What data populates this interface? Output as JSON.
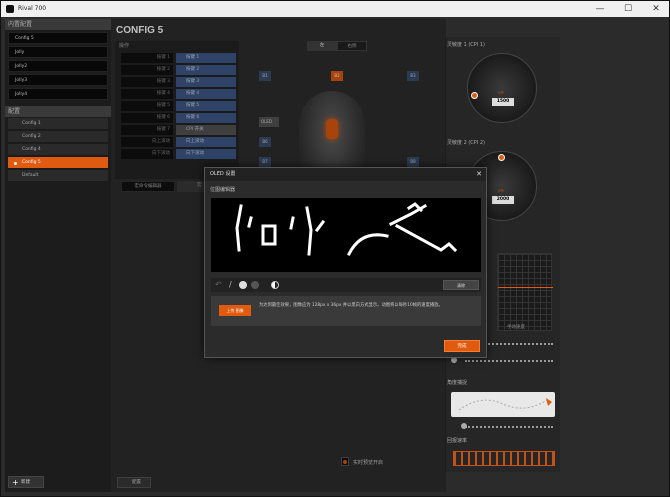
{
  "window": {
    "title": "Rival 700",
    "minimize": "—",
    "maximize": "☐",
    "close": "✕"
  },
  "sidebar": {
    "library_header": "内置配置",
    "library_items": [
      "Config 5",
      "Jolly",
      "Jolly2",
      "Jolly3",
      "Jolly4"
    ],
    "configs_header": "配置",
    "configs": [
      {
        "label": "Config 1",
        "active": false
      },
      {
        "label": "Config 2",
        "active": false
      },
      {
        "label": "Config 4",
        "active": false
      },
      {
        "label": "Config 5",
        "active": true
      },
      {
        "label": "Default",
        "active": false
      }
    ],
    "new_button": "新建"
  },
  "main": {
    "title": "CONFIG 5",
    "ops_label": "操作",
    "operations": [
      {
        "key": "按键 1",
        "value": "按键 1"
      },
      {
        "key": "按键 2",
        "value": "按键 2"
      },
      {
        "key": "按键 3",
        "value": "按键 3"
      },
      {
        "key": "按键 4",
        "value": "按键 4"
      },
      {
        "key": "按键 5",
        "value": "按键 5"
      },
      {
        "key": "按键 6",
        "value": "按键 6"
      },
      {
        "key": "按键 7",
        "value": "CPI 开关"
      },
      {
        "key": "向上滚动",
        "value": "向上滚动"
      },
      {
        "key": "向下滚动",
        "value": "向下滚动"
      }
    ],
    "macro_editor": "宏命令编辑器",
    "macro_editor2": "宏",
    "side_left": "左",
    "side_right": "右侧",
    "button_tags": [
      "B1",
      "B2",
      "B3",
      "B4",
      "B5",
      "B6",
      "B7",
      "B8"
    ],
    "oled_tag": "OLED",
    "config_button": "配置",
    "realtime": "实时预览开启"
  },
  "right": {
    "sens1_label": "灵敏度 1 (CPI 1)",
    "sens1_value": "1500",
    "sens2_label": "灵敏度 2 (CPI 2)",
    "sens2_value": "2000",
    "cpi_text": "CPI",
    "accel_label": "手动速度",
    "angle_label": "角度捕捉",
    "poll_label": "回报速率"
  },
  "dialog": {
    "title": "OLED 设置",
    "subtitle": "位图编辑器",
    "clear_button": "清除",
    "upload_button": "上传 图像",
    "upload_text": "为达到最佳效果，图像应为 128px x 36px 并以黑白方式显示。动图将以每秒10帧的速度播放。",
    "done_button": "完成"
  },
  "colors": {
    "accent": "#e05a0f",
    "blue": "#3e5a8a"
  }
}
